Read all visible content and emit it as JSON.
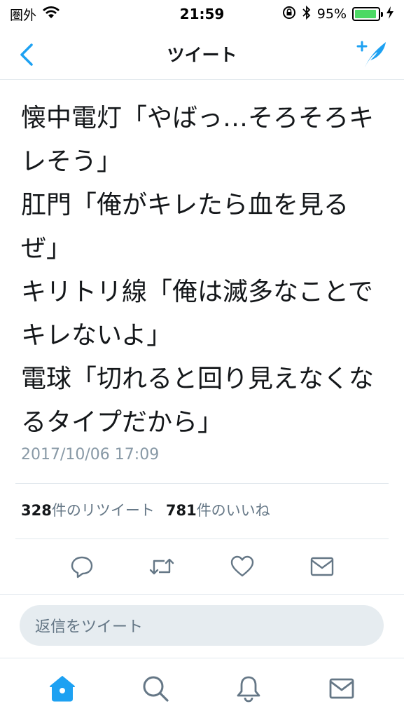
{
  "status_bar": {
    "carrier": "圏外",
    "time": "21:59",
    "battery_percent": "95%",
    "battery_level": 0.95
  },
  "nav": {
    "title": "ツイート"
  },
  "tweet": {
    "paragraphs": [
      "懐中電灯「やばっ…そろそろキレそう」",
      "肛門「俺がキレたら血を見るぜ」",
      "キリトリ線「俺は滅多なことでキレないよ」",
      "電球「切れると回り見えなくなるタイプだから」"
    ],
    "timestamp": "2017/10/06 17:09",
    "retweet_count": "328",
    "retweet_label": "件のリツイート",
    "like_count": "781",
    "like_label": "件のいいね"
  },
  "reply": {
    "placeholder": "返信をツイート"
  },
  "colors": {
    "accent": "#1da1f2",
    "icon_gray": "#657786",
    "battery_green": "#4cd964"
  },
  "icons": {
    "back": "chevron-left-icon",
    "compose": "compose-tweet-icon",
    "reply": "reply-icon",
    "retweet": "retweet-icon",
    "like": "heart-icon",
    "dm": "envelope-icon",
    "home": "home-icon",
    "search": "search-icon",
    "notifications": "bell-icon",
    "messages": "envelope-icon"
  }
}
